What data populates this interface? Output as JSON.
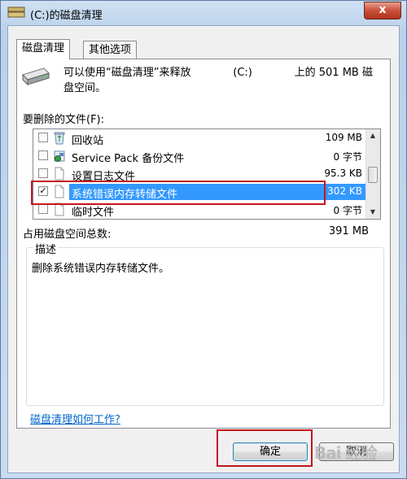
{
  "window": {
    "title": "(C:)的磁盘清理",
    "close_glyph": "x"
  },
  "tabs": [
    {
      "label": "磁盘清理"
    },
    {
      "label": "其他选项"
    }
  ],
  "intro": {
    "line1_left": "可以使用“磁盘清理”来释放",
    "line1_drive": "(C:)",
    "line1_right": "上的 501 MB 磁",
    "line2": "盘空间。"
  },
  "files_label": "要删除的文件(F):",
  "files": [
    {
      "name": "回收站",
      "size": "109 MB",
      "checked": false,
      "icon": "recycle-bin-icon"
    },
    {
      "name": "Service Pack 备份文件",
      "size": "0 字节",
      "checked": false,
      "icon": "service-pack-icon"
    },
    {
      "name": "设置日志文件",
      "size": "95.3 KB",
      "checked": false,
      "icon": "file-icon"
    },
    {
      "name": "系统错误内存转储文件",
      "size": "302 KB",
      "checked": true,
      "icon": "file-icon"
    },
    {
      "name": "临时文件",
      "size": "0 字节",
      "checked": false,
      "icon": "file-icon"
    }
  ],
  "check_glyph": "✓",
  "total": {
    "label": "占用磁盘空间总数:",
    "value": "391 MB"
  },
  "description": {
    "title": "描述",
    "text": "删除系统错误内存转储文件。"
  },
  "help_link": "磁盘清理如何工作?",
  "buttons": {
    "ok": "确定",
    "cancel": "取消"
  },
  "watermark": "Bai 经验",
  "colors": {
    "selection": "#3399ff",
    "annotation_red": "#c4161c",
    "link": "#0066cc"
  }
}
